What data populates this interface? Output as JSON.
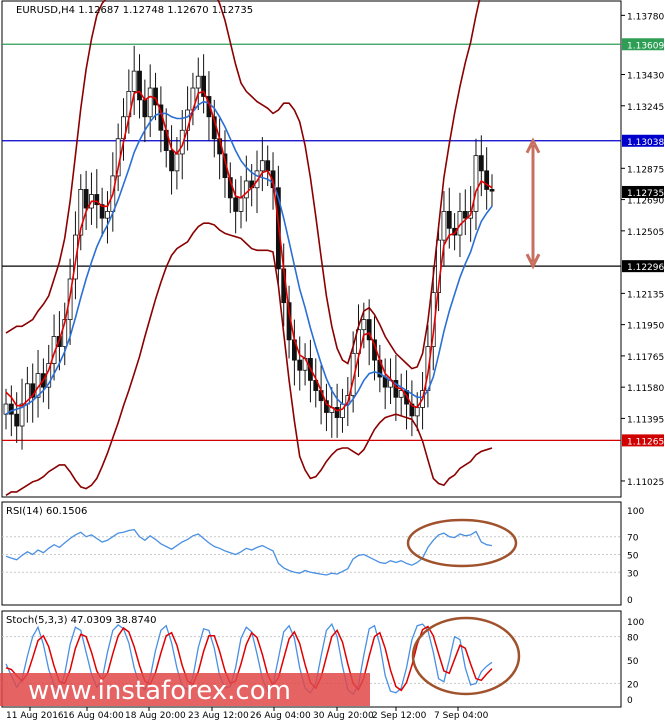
{
  "header": {
    "symbol_line": "EURUSD,H4  1.12687 1.12748 1.12670 1.12735"
  },
  "colors": {
    "background": "#ffffff",
    "frame": "#000000",
    "grid": "#000000",
    "candle": "#111111",
    "bollinger": "#8b0000",
    "ma_fast": "#e00000",
    "ma_slow": "#2a6fd6",
    "resistance_green": "#2e9e55",
    "resistance_blue": "#0000cc",
    "support_black": "#000000",
    "support_red": "#d00000",
    "rsi": "#4a90e2",
    "stoch_main": "#4a90e2",
    "stoch_signal": "#e00000",
    "ellipse": "#a0522d",
    "arrow": "#c87060",
    "watermark_band": "#e04848",
    "watermark_text": "#ffffff"
  },
  "price_axis": {
    "min": 1.1093,
    "max": 1.13865,
    "ticks": [
      "1.13780",
      "1.13430",
      "1.13245",
      "1.12875",
      "1.12690",
      "1.12505",
      "1.12135",
      "1.11950",
      "1.11765",
      "1.11580",
      "1.11395",
      "1.11025"
    ],
    "tick_values": [
      1.1378,
      1.1343,
      1.13245,
      1.12875,
      1.1269,
      1.12505,
      1.12135,
      1.1195,
      1.11765,
      1.1158,
      1.11395,
      1.11025
    ]
  },
  "levels": [
    {
      "name": "level-1-13609",
      "value": 1.13609,
      "label": "1.13609",
      "color": "#2e9e55"
    },
    {
      "name": "level-1-13038",
      "value": 1.13038,
      "label": "1.13038",
      "color": "#0000cc"
    },
    {
      "name": "level-1-12296",
      "value": 1.12296,
      "label": "1.12296",
      "color": "#000000"
    },
    {
      "name": "level-1-11265",
      "value": 1.11265,
      "label": "1.11265",
      "color": "#d00000"
    }
  ],
  "current_price": {
    "value": 1.12735,
    "label": "1.12735"
  },
  "x_labels": [
    "11 Aug 2016",
    "16 Aug 04:00",
    "18 Aug 20:00",
    "23 Aug 12:00",
    "26 Aug 04:00",
    "30 Aug 20:00",
    "2 Sep 12:00",
    "7 Sep 04:00"
  ],
  "rsi": {
    "title": "RSI(14) 60.1506",
    "min": 0,
    "max": 100,
    "ticks": [
      "100",
      "70",
      "50",
      "30",
      "0"
    ],
    "tick_values": [
      100,
      70,
      50,
      30,
      0
    ]
  },
  "stoch": {
    "title": "Stoch(5,3,3) 47.0309 38.8740",
    "min": 0,
    "max": 100,
    "ticks": [
      "100",
      "80",
      "50",
      "20",
      "0"
    ],
    "tick_values": [
      100,
      80,
      50,
      20,
      0
    ]
  },
  "watermark": {
    "text": "www.instaforex.com"
  },
  "chart_data": {
    "type": "candlestick",
    "title": "EURUSD,H4",
    "ylim": [
      1.1093,
      1.13865
    ],
    "close": [
      1.1148,
      1.1142,
      1.1135,
      1.1148,
      1.116,
      1.1152,
      1.1166,
      1.1158,
      1.1172,
      1.1188,
      1.1182,
      1.1198,
      1.1222,
      1.1248,
      1.1275,
      1.1264,
      1.1272,
      1.1266,
      1.1258,
      1.1262,
      1.1283,
      1.1305,
      1.1318,
      1.1333,
      1.1345,
      1.1328,
      1.1318,
      1.1335,
      1.1325,
      1.131,
      1.1298,
      1.1286,
      1.1296,
      1.131,
      1.1322,
      1.1335,
      1.1342,
      1.133,
      1.1318,
      1.1305,
      1.1296,
      1.1282,
      1.127,
      1.1262,
      1.127,
      1.128,
      1.1276,
      1.1286,
      1.1292,
      1.1286,
      1.1276,
      1.1228,
      1.1208,
      1.1186,
      1.1174,
      1.1168,
      1.1175,
      1.1162,
      1.1156,
      1.115,
      1.1143,
      1.1146,
      1.114,
      1.1148,
      1.1153,
      1.1178,
      1.1192,
      1.1198,
      1.1186,
      1.1174,
      1.1164,
      1.1158,
      1.1162,
      1.1152,
      1.1156,
      1.1148,
      1.1141,
      1.1146,
      1.1156,
      1.1182,
      1.1214,
      1.1245,
      1.1262,
      1.1252,
      1.1248,
      1.1262,
      1.1258,
      1.1262,
      1.1295,
      1.1286,
      1.1275,
      1.1274
    ],
    "ma_fast": [
      1.1155,
      1.1152,
      1.1147,
      1.1147,
      1.115,
      1.1153,
      1.1158,
      1.1162,
      1.1168,
      1.1178,
      1.1186,
      1.1196,
      1.1212,
      1.1232,
      1.1252,
      1.1262,
      1.1268,
      1.1268,
      1.1265,
      1.1265,
      1.1272,
      1.1288,
      1.1303,
      1.1317,
      1.1332,
      1.1333,
      1.1328,
      1.133,
      1.1329,
      1.1321,
      1.131,
      1.1299,
      1.1296,
      1.1301,
      1.1311,
      1.1322,
      1.1332,
      1.1333,
      1.1326,
      1.1316,
      1.1305,
      1.1292,
      1.128,
      1.1271,
      1.127,
      1.1273,
      1.1276,
      1.128,
      1.1285,
      1.1286,
      1.128,
      1.1255,
      1.1228,
      1.1202,
      1.1186,
      1.1177,
      1.1175,
      1.1169,
      1.1163,
      1.1156,
      1.1148,
      1.1146,
      1.1144,
      1.1145,
      1.1149,
      1.1162,
      1.1176,
      1.1189,
      1.119,
      1.1183,
      1.1174,
      1.1166,
      1.1163,
      1.1158,
      1.1157,
      1.1153,
      1.1147,
      1.1146,
      1.1151,
      1.1166,
      1.119,
      1.1218,
      1.1242,
      1.1248,
      1.1249,
      1.1254,
      1.1257,
      1.126,
      1.1274,
      1.128,
      1.1278,
      1.1276
    ],
    "ma_slow": [
      1.1142,
      1.1144,
      1.1145,
      1.1146,
      1.1148,
      1.115,
      1.1153,
      1.1156,
      1.116,
      1.1166,
      1.1172,
      1.1179,
      1.1188,
      1.1199,
      1.1211,
      1.1222,
      1.1232,
      1.1241,
      1.1248,
      1.1254,
      1.1261,
      1.1269,
      1.1278,
      1.1287,
      1.1297,
      1.1304,
      1.131,
      1.1315,
      1.1319,
      1.132,
      1.132,
      1.1318,
      1.1317,
      1.1317,
      1.1318,
      1.1321,
      1.1325,
      1.1327,
      1.1326,
      1.1323,
      1.1318,
      1.1312,
      1.1305,
      1.1298,
      1.1292,
      1.1288,
      1.1285,
      1.1283,
      1.1282,
      1.1281,
      1.1279,
      1.127,
      1.1258,
      1.1244,
      1.123,
      1.1216,
      1.1205,
      1.1193,
      1.1182,
      1.1172,
      1.1163,
      1.1156,
      1.1151,
      1.1148,
      1.1147,
      1.1151,
      1.1156,
      1.1162,
      1.1166,
      1.1167,
      1.1166,
      1.1164,
      1.1162,
      1.116,
      1.1158,
      1.1156,
      1.1154,
      1.1152,
      1.1152,
      1.1156,
      1.1164,
      1.1177,
      1.1191,
      1.1203,
      1.1213,
      1.1223,
      1.1231,
      1.1238,
      1.1248,
      1.1256,
      1.1261,
      1.1265
    ],
    "bb_upper": [
      1.119,
      1.1192,
      1.1194,
      1.1194,
      1.1196,
      1.1198,
      1.1203,
      1.1207,
      1.1212,
      1.1222,
      1.1232,
      1.1246,
      1.1268,
      1.1295,
      1.1323,
      1.1346,
      1.1364,
      1.1378,
      1.1385,
      1.1389,
      1.1394,
      1.1401,
      1.1409,
      1.1418,
      1.1428,
      1.1432,
      1.1432,
      1.1431,
      1.1428,
      1.1421,
      1.1411,
      1.14,
      1.1394,
      1.1392,
      1.1392,
      1.1393,
      1.1397,
      1.1399,
      1.1397,
      1.1392,
      1.1385,
      1.1375,
      1.1362,
      1.1349,
      1.1338,
      1.1333,
      1.133,
      1.1327,
      1.1325,
      1.1323,
      1.132,
      1.1322,
      1.1326,
      1.1326,
      1.1322,
      1.1315,
      1.1301,
      1.1282,
      1.1259,
      1.1235,
      1.1212,
      1.1194,
      1.1181,
      1.1174,
      1.1172,
      1.1182,
      1.1194,
      1.1203,
      1.1205,
      1.1201,
      1.1195,
      1.1188,
      1.1183,
      1.1178,
      1.1175,
      1.1172,
      1.1169,
      1.117,
      1.1178,
      1.1197,
      1.1224,
      1.1253,
      1.1282,
      1.1302,
      1.132,
      1.1336,
      1.135,
      1.1362,
      1.1378,
      1.1392,
      1.1402,
      1.1408
    ],
    "bb_lower": [
      1.1094,
      1.1096,
      1.1096,
      1.1098,
      1.11,
      1.1102,
      1.1103,
      1.1105,
      1.1108,
      1.111,
      1.1112,
      1.1112,
      1.1108,
      1.1103,
      1.1099,
      1.1098,
      1.11,
      1.1104,
      1.1111,
      1.1119,
      1.1128,
      1.1137,
      1.1147,
      1.1156,
      1.1166,
      1.1176,
      1.1188,
      1.1199,
      1.121,
      1.122,
      1.1229,
      1.1236,
      1.124,
      1.1242,
      1.1244,
      1.1249,
      1.1253,
      1.1255,
      1.1255,
      1.1254,
      1.1251,
      1.1249,
      1.1248,
      1.1247,
      1.1246,
      1.1243,
      1.124,
      1.1239,
      1.1239,
      1.1239,
      1.1238,
      1.1218,
      1.119,
      1.1162,
      1.1138,
      1.1117,
      1.1109,
      1.1104,
      1.1105,
      1.1109,
      1.1114,
      1.1118,
      1.1121,
      1.1122,
      1.1122,
      1.112,
      1.1118,
      1.1121,
      1.1127,
      1.1133,
      1.1137,
      1.114,
      1.1141,
      1.1142,
      1.1141,
      1.114,
      1.1139,
      1.1134,
      1.1126,
      1.1115,
      1.1104,
      1.1101,
      1.11,
      1.1104,
      1.1106,
      1.111,
      1.1112,
      1.1114,
      1.1118,
      1.112,
      1.1121,
      1.1122
    ],
    "rsi": [
      48,
      46,
      44,
      49,
      53,
      50,
      55,
      52,
      57,
      61,
      58,
      63,
      68,
      72,
      75,
      70,
      72,
      68,
      64,
      66,
      70,
      74,
      75,
      77,
      78,
      70,
      66,
      71,
      67,
      62,
      59,
      56,
      60,
      64,
      67,
      71,
      73,
      68,
      63,
      59,
      57,
      54,
      52,
      50,
      53,
      57,
      55,
      58,
      60,
      57,
      54,
      40,
      35,
      32,
      30,
      29,
      32,
      30,
      29,
      28,
      27,
      29,
      28,
      31,
      34,
      45,
      49,
      50,
      47,
      44,
      41,
      40,
      43,
      41,
      43,
      40,
      38,
      41,
      46,
      58,
      66,
      72,
      74,
      70,
      69,
      73,
      71,
      72,
      76,
      64,
      61,
      60
    ],
    "stoch_k": [
      45,
      30,
      15,
      25,
      55,
      80,
      92,
      70,
      38,
      18,
      10,
      32,
      70,
      92,
      88,
      60,
      32,
      15,
      25,
      60,
      88,
      95,
      90,
      72,
      40,
      18,
      12,
      28,
      62,
      88,
      94,
      72,
      40,
      16,
      12,
      28,
      66,
      90,
      88,
      65,
      30,
      14,
      16,
      40,
      78,
      92,
      86,
      58,
      26,
      10,
      18,
      52,
      86,
      94,
      78,
      40,
      14,
      8,
      20,
      55,
      88,
      96,
      80,
      42,
      12,
      6,
      18,
      56,
      90,
      94,
      70,
      30,
      10,
      8,
      14,
      40,
      76,
      94,
      96,
      88,
      60,
      26,
      22,
      50,
      80,
      76,
      40,
      18,
      20,
      35,
      42,
      47
    ],
    "stoch_d": [
      40,
      38,
      30,
      23,
      32,
      53,
      75,
      81,
      67,
      42,
      22,
      20,
      37,
      65,
      83,
      80,
      60,
      36,
      24,
      33,
      58,
      81,
      91,
      86,
      67,
      43,
      23,
      19,
      34,
      59,
      81,
      85,
      69,
      43,
      23,
      19,
      35,
      61,
      81,
      81,
      61,
      36,
      20,
      23,
      45,
      70,
      85,
      79,
      57,
      31,
      18,
      27,
      52,
      77,
      86,
      71,
      44,
      21,
      14,
      28,
      54,
      80,
      88,
      73,
      45,
      20,
      12,
      27,
      55,
      80,
      85,
      65,
      37,
      16,
      11,
      21,
      43,
      70,
      89,
      93,
      81,
      58,
      36,
      33,
      51,
      69,
      65,
      45,
      26,
      24,
      32,
      39
    ]
  }
}
